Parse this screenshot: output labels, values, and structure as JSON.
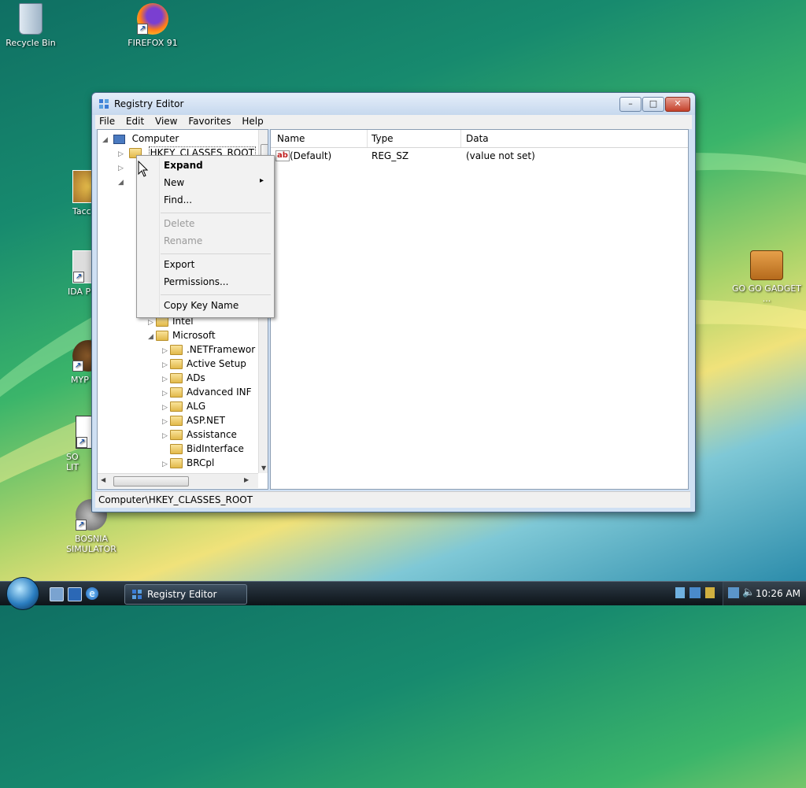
{
  "desktop": {
    "icons": [
      {
        "label": "Recycle Bin"
      },
      {
        "label": "FIREFOX 91"
      },
      {
        "label": "Tacc"
      },
      {
        "label": "IDA P"
      },
      {
        "label": "MYP"
      },
      {
        "label": "SO LIT"
      },
      {
        "label": "BOSNIA SIMULATOR"
      },
      {
        "label": "GO GO GADGET ..."
      }
    ]
  },
  "window": {
    "title": "Registry Editor",
    "controls": {
      "minimize": "–",
      "maximize": "□",
      "close": "✕"
    },
    "menu": [
      "File",
      "Edit",
      "View",
      "Favorites",
      "Help"
    ],
    "tree": {
      "computer": "Computer",
      "selected": "HKEY_CLASSES_ROOT",
      "items_level2": [
        "Intel",
        "Microsoft"
      ],
      "items_level3": [
        ".NETFramewor",
        "Active Setup",
        "ADs",
        "Advanced INF",
        "ALG",
        "ASP.NET",
        "Assistance",
        "BidInterface",
        "BRCpl"
      ]
    },
    "list": {
      "columns": [
        "Name",
        "Type",
        "Data"
      ],
      "rows": [
        {
          "name": "(Default)",
          "type": "REG_SZ",
          "data": "(value not set)",
          "icon": "ab"
        }
      ]
    },
    "status": "Computer\\HKEY_CLASSES_ROOT"
  },
  "context_menu": {
    "items": [
      {
        "label": "Expand",
        "state": "default"
      },
      {
        "label": "New",
        "state": "submenu"
      },
      {
        "label": "Find...",
        "state": "normal"
      },
      {
        "label": "Delete",
        "state": "disabled"
      },
      {
        "label": "Rename",
        "state": "disabled"
      },
      {
        "label": "Export",
        "state": "normal"
      },
      {
        "label": "Permissions...",
        "state": "normal"
      },
      {
        "label": "Copy Key Name",
        "state": "normal"
      }
    ],
    "submenu_arrow": "▸"
  },
  "taskbar": {
    "task": "Registry Editor",
    "clock": "10:26 AM"
  }
}
